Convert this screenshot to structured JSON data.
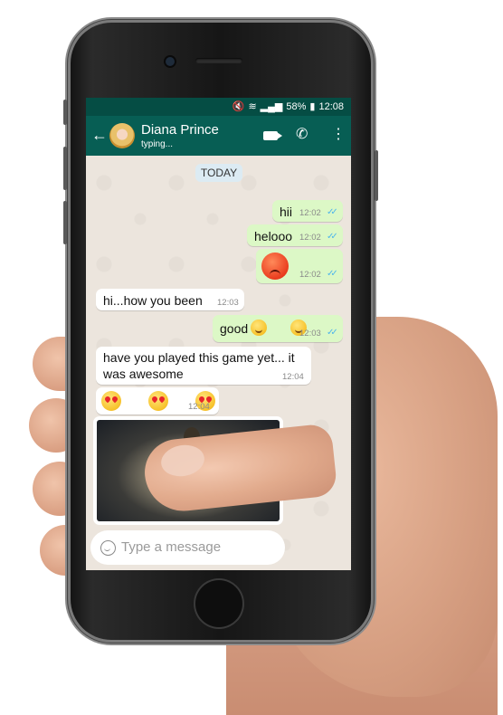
{
  "status_bar": {
    "icons": [
      "mute-icon",
      "wifi-icon",
      "signal-icon",
      "battery-icon"
    ],
    "battery": "58%",
    "time": "12:08"
  },
  "header": {
    "contact_name": "Diana Prince",
    "contact_status": "typing...",
    "icons": [
      "back-arrow-icon",
      "video-call-icon",
      "phone-call-icon",
      "menu-icon"
    ]
  },
  "date_chip": "TODAY",
  "messages": [
    {
      "dir": "out",
      "text": "hii",
      "time": "12:02",
      "read": true
    },
    {
      "dir": "out",
      "text": "helooo",
      "time": "12:02",
      "read": true
    },
    {
      "dir": "out",
      "emoji": "angry-face",
      "time": "12:02",
      "read": true
    },
    {
      "dir": "in",
      "text": "hi...how you been",
      "time": "12:03"
    },
    {
      "dir": "out",
      "text": "good",
      "emoji": "smiley x2",
      "time": "12:03",
      "read": true
    },
    {
      "dir": "in",
      "text_line1": "have you played this game yet... it",
      "text_line2": "was awesome",
      "time": "12:04"
    },
    {
      "dir": "in",
      "emoji": "heart-eyes x3",
      "time": "12:04"
    },
    {
      "dir": "in",
      "type": "image"
    }
  ],
  "composer": {
    "placeholder": "Type a message"
  },
  "colors": {
    "header": "#075e54",
    "status_bar": "#054d44",
    "outgoing_bubble": "#dcf8c6",
    "incoming_bubble": "#ffffff",
    "chat_background": "#ece5dd",
    "read_ticks": "#4fb6ec"
  }
}
